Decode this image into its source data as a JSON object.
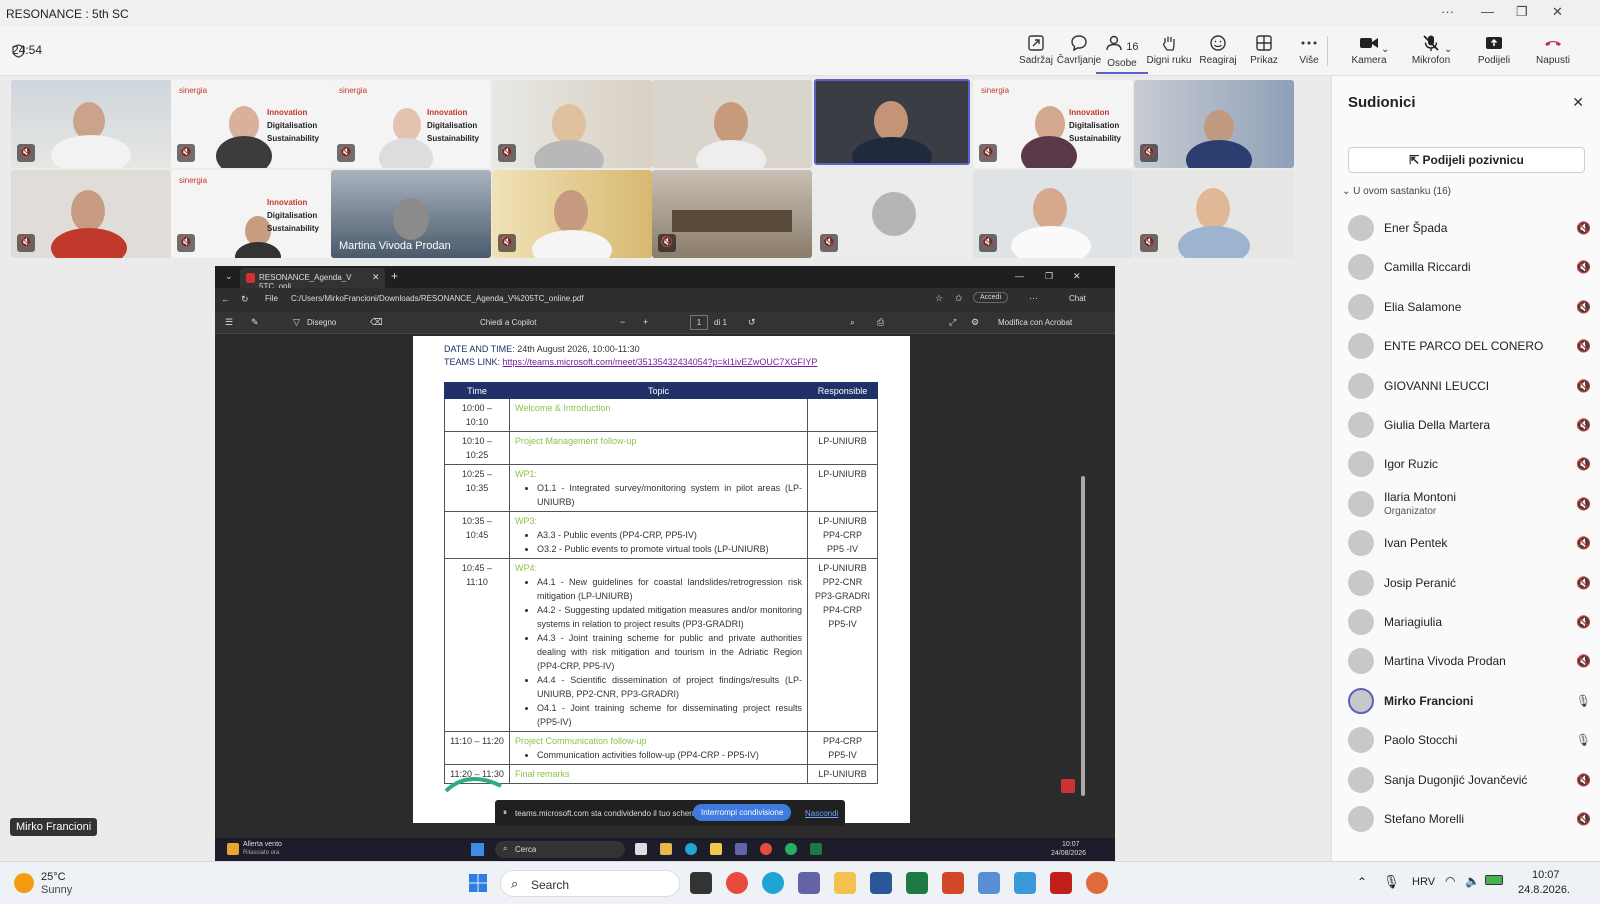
{
  "window": {
    "title": "RESONANCE : 5th SC"
  },
  "meeting": {
    "timer": "24:54"
  },
  "toolbar": {
    "content": "Sadržaj",
    "chat": "Čavrljanje",
    "people": "Osobe",
    "people_count": "16",
    "raise": "Digni ruku",
    "react": "Reagiraj",
    "view": "Prikaz",
    "more": "Više",
    "camera": "Kamera",
    "mic": "Mikrofon",
    "share": "Podijeli",
    "leave": "Napusti"
  },
  "tiles": {
    "brand": "sinergia",
    "label": [
      "Innovation",
      "Digitalisation",
      "Sustainability"
    ],
    "named": "Martina Vivoda Prodan",
    "self": "Mirko Francioni"
  },
  "browser": {
    "tab": "RESONANCE_Agenda_V 5TC_onli",
    "address_label": "File",
    "address": "C:/Users/MirkoFrancioni/Downloads/RESONANCE_Agenda_V%205TC_online.pdf",
    "login": "Accedi",
    "chat": "Chat",
    "draw": "Disegno",
    "copilot": "Chiedi a Copilot",
    "page": "1",
    "page_of": "di 1",
    "acrobat": "Modifica con Acrobat"
  },
  "agenda": {
    "date_label": "DATE AND TIME:",
    "date_value": "24th August 2026, 10:00-11:30",
    "teams_label": "TEAMS LINK:",
    "teams_link": "https://teams.microsoft.com/meet/35135432434054?p=kI1ivEZwOUC7XGFIYP",
    "headers": [
      "Time",
      "Topic",
      "Responsible"
    ],
    "rows": [
      {
        "time": "10:00 – 10:10",
        "topic": "Welcome & Introduction",
        "items": [],
        "resp": ""
      },
      {
        "time": "10:10 – 10:25",
        "topic": "Project Management follow-up",
        "items": [],
        "resp": "LP-UNIURB"
      },
      {
        "time": "10:25 – 10:35",
        "topic": "WP1:",
        "items": [
          "O1.1 - Integrated survey/monitoring system in pilot areas (LP-UNIURB)"
        ],
        "resp": "LP-UNIURB"
      },
      {
        "time": "10:35 – 10:45",
        "topic": "WP3:",
        "items": [
          "A3.3 - Public events (PP4-CRP, PP5-IV)",
          "O3.2 - Public events to promote virtual tools (LP-UNIURB)"
        ],
        "resp": "LP-UNIURB\nPP4-CRP\nPP5 -IV"
      },
      {
        "time": "10:45 – 11:10",
        "topic": "WP4:",
        "items": [
          "A4.1 - New guidelines for coastal landslides/retrogression risk mitigation (LP-UNIURB)",
          "A4.2 - Suggesting updated mitigation measures and/or monitoring systems in relation to project results (PP3-GRADRI)",
          "A4.3 - Joint training scheme for public and private authorities dealing with risk mitigation and tourism in the Adriatic Region (PP4-CRP, PP5-IV)",
          "A4.4 - Scientific dissemination of project findings/results (LP-UNIURB, PP2-CNR, PP3-GRADRI)",
          "O4.1 - Joint training scheme for disseminating project results (PP5-IV)"
        ],
        "resp": "LP-UNIURB\nPP2-CNR\nPP3-GRADRI\nPP4-CRP\nPP5-IV"
      },
      {
        "time": "11:10 – 11:20",
        "topic": "Project Communication follow-up",
        "items": [
          "Communication activities follow-up (PP4-CRP - PP5-IV)"
        ],
        "resp": "PP4-CRP\nPP5-IV"
      },
      {
        "time": "11:20 – 11:30",
        "topic": "Final remarks",
        "items": [],
        "resp": "LP-UNIURB"
      }
    ]
  },
  "sharebar": {
    "text": "teams.microsoft.com sta condividendo il tuo schermo.",
    "stop": "Interrompi condivisione",
    "hide": "Nascondi"
  },
  "inner_taskbar": {
    "alert": "Allerta vento",
    "alert_sub": "Rilasciato ora",
    "search": "Cerca",
    "time": "10:07",
    "date": "24/08/2026"
  },
  "panel": {
    "title": "Sudionici",
    "invite": "Podijeli pozivnicu",
    "section": "U ovom sastanku (16)",
    "participants": [
      {
        "name": "Ener Špada",
        "role": ""
      },
      {
        "name": "Camilla Riccardi",
        "role": ""
      },
      {
        "name": "Elia Salamone",
        "role": ""
      },
      {
        "name": "ENTE PARCO DEL CONERO",
        "role": ""
      },
      {
        "name": "GIOVANNI LEUCCI",
        "role": ""
      },
      {
        "name": "Giulia Della Martera",
        "role": ""
      },
      {
        "name": "Igor Ruzic",
        "role": ""
      },
      {
        "name": "Ilaria Montoni",
        "role": "Organizator"
      },
      {
        "name": "Ivan Pentek",
        "role": ""
      },
      {
        "name": "Josip Peranić",
        "role": ""
      },
      {
        "name": "Mariagiulia",
        "role": ""
      },
      {
        "name": "Martina Vivoda Prodan",
        "role": ""
      },
      {
        "name": "Mirko Francioni",
        "role": ""
      },
      {
        "name": "Paolo Stocchi",
        "role": ""
      },
      {
        "name": "Sanja Dugonjić Jovančević",
        "role": ""
      },
      {
        "name": "Stefano Morelli",
        "role": ""
      }
    ]
  },
  "taskbar": {
    "temp": "25°C",
    "weather": "Sunny",
    "search": "Search",
    "lang": "HRV",
    "time": "10:07",
    "date": "24.8.2026."
  }
}
